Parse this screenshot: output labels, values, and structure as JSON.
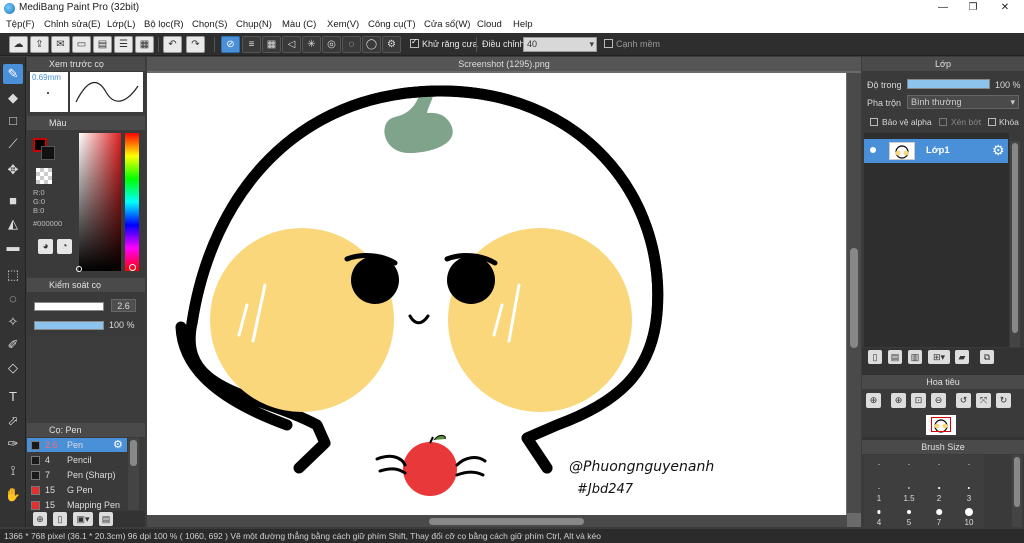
{
  "window": {
    "title": "MediBang Paint Pro (32bit)"
  },
  "menu": [
    "Tệp(F)",
    "Chỉnh sửa(E)",
    "Lớp(L)",
    "Bộ lọc(R)",
    "Chọn(S)",
    "Chụp(N)",
    "Màu (C)",
    "Xem(V)",
    "Công cụ(T)",
    "Cửa sổ(W)",
    "Cloud",
    "Help"
  ],
  "toolbar": {
    "antialias_label": "Khử răng cưa",
    "adjust_label": "Điều chỉnh",
    "adjust_value": "40",
    "canh_mem_label": "Cạnh mềm"
  },
  "document": {
    "tab_title": "Screenshot (1295).png"
  },
  "left": {
    "brush_preview": {
      "title": "Xem trước cọ",
      "size_text": "0.69mm"
    },
    "color": {
      "title": "Màu",
      "r": "R:0",
      "g": "G:0",
      "b": "B:0",
      "hex": "#000000"
    },
    "brush_control": {
      "title": "Kiểm soát cọ",
      "size": "2.6",
      "opacity": "100 %",
      "opacity_fraction": 1.0
    },
    "brush_list": {
      "title": "Cọ: Pen",
      "items": [
        {
          "size": "2.6",
          "name": "Pen",
          "color": "#1a1a1a",
          "selected": true
        },
        {
          "size": "4",
          "name": "Pencil",
          "color": "#1a1a1a"
        },
        {
          "size": "7",
          "name": "Pen (Sharp)",
          "color": "#1a1a1a"
        },
        {
          "size": "15",
          "name": "G Pen",
          "color": "#e03030"
        },
        {
          "size": "15",
          "name": "Mapping Pen",
          "color": "#e03030"
        }
      ]
    }
  },
  "right": {
    "layer": {
      "title": "Lớp",
      "opacity_label": "Độ trong",
      "opacity_value": "100 %",
      "opacity_fraction": 1.0,
      "blend_label": "Pha trộn",
      "blend_value": "Bình thường",
      "protect_alpha": "Bảo vệ alpha",
      "clipping": "Xén bớt",
      "lock": "Khóa",
      "layer_name": "Lớp1"
    },
    "navigator": {
      "title": "Hoa tiêu"
    },
    "brush_size": {
      "title": "Brush Size",
      "sizes": [
        "",
        "",
        "",
        "",
        "1",
        "1.5",
        "2",
        "3",
        "4",
        "5",
        "7",
        "10"
      ]
    }
  },
  "artwork": {
    "signature_line1": "@Phuongnguyenanh",
    "signature_line2": "#Jbd247"
  },
  "status": {
    "text": "1366 * 768 pixel  (36.1 * 20.3cm)  96 dpi  100 %  ( 1060, 692 )  Vẽ một đường thẳng bằng cách giữ phím Shift, Thay đổi cỡ cọ bằng cách giữ phím Ctrl, Alt và kéo"
  },
  "colors": {
    "accent": "#4a90d9",
    "cheek": "#f9d77a",
    "leaf": "#7fa38b",
    "apple": "#e8383a"
  }
}
